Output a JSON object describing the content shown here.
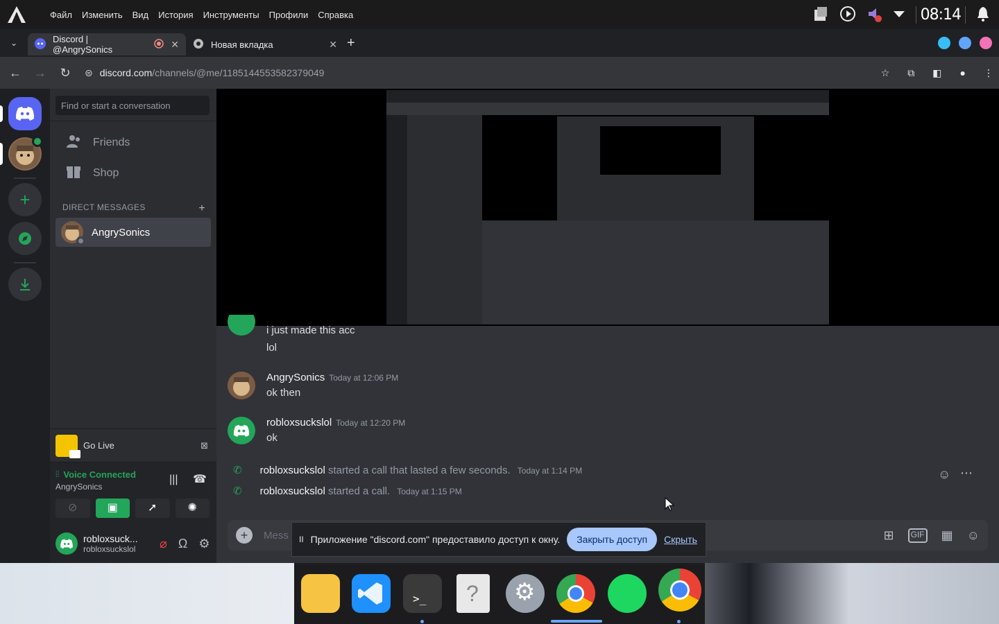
{
  "topbar": {
    "menu": [
      "Файл",
      "Изменить",
      "Вид",
      "История",
      "Инструменты",
      "Профили",
      "Справка"
    ],
    "clock": "08:14"
  },
  "tabs": [
    {
      "title": "Discord | @AngrySonics",
      "active": true
    },
    {
      "title": "Новая вкладка",
      "active": false
    }
  ],
  "address": {
    "domain": "discord.com",
    "path": "/channels/@me/1185144553582379049"
  },
  "sidebar": {
    "search_placeholder": "Find or start a conversation",
    "nav": [
      {
        "label": "Friends",
        "icon": "friends-icon"
      },
      {
        "label": "Shop",
        "icon": "shop-icon"
      }
    ],
    "dm_header": "DIRECT MESSAGES",
    "dm_add": "+",
    "dms": [
      {
        "name": "AngrySonics"
      }
    ]
  },
  "golive": {
    "label": "Go Live"
  },
  "voice": {
    "status": "Voice Connected",
    "channel": "AngrySonics"
  },
  "user": {
    "display": "robloxsuck...",
    "username": "robloxsuckslol"
  },
  "messages": [
    {
      "kind": "continuation",
      "lines": [
        "i just made this acc",
        "lol"
      ]
    },
    {
      "kind": "message",
      "author": "AngrySonics",
      "time": "Today at 12:06 PM",
      "text": "ok then"
    },
    {
      "kind": "message",
      "author": "robloxsuckslol",
      "time": "Today at 12:20 PM",
      "text": "ok"
    },
    {
      "kind": "system",
      "author": "robloxsuckslol",
      "text": "started a call that lasted a few seconds.",
      "time": "Today at 1:14 PM"
    },
    {
      "kind": "system",
      "author": "robloxsuckslol",
      "text": "started a call.",
      "time": "Today at 1:15 PM"
    }
  ],
  "composer": {
    "placeholder": "Mess"
  },
  "share_bar": {
    "pause": "II",
    "text": "Приложение \"discord.com\" предоставило доступ к окну.",
    "stop_button": "Закрыть доступ",
    "hide_link": "Скрыть"
  },
  "colors": {
    "discord_blurple": "#5865f2",
    "green": "#23a55a",
    "bg_main": "#313338",
    "bg_side": "#2b2d31",
    "bg_guilds": "#1e1f22"
  }
}
